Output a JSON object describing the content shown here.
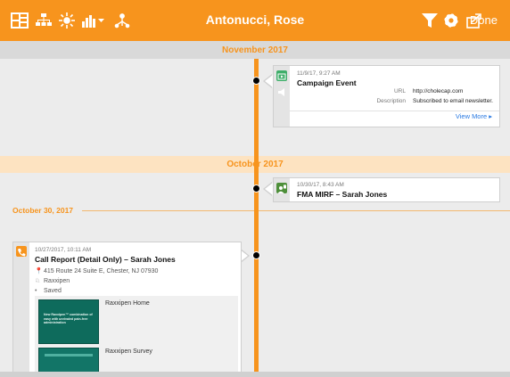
{
  "header": {
    "title": "Antonucci, Rose",
    "done_label": "Done",
    "icons": [
      "layout-icon",
      "hierarchy-icon",
      "sun-icon",
      "bar-chart-dropdown-icon",
      "network-icon",
      "filter-icon",
      "gear-icon",
      "share-icon"
    ]
  },
  "bands": {
    "november": "November 2017",
    "october": "October 2017"
  },
  "events": {
    "campaign": {
      "timestamp": "11/9/17, 9:27 AM",
      "title": "Campaign Event",
      "url_key": "URL",
      "url_val": "http://cholecap.com",
      "desc_key": "Description",
      "desc_val": "Subscribed to email newsletter.",
      "view_more": "View More ▸"
    },
    "fma": {
      "timestamp": "10/30/17, 8:43 AM",
      "title": "FMA MIRF – Sarah Jones"
    },
    "date_divider": "October 30, 2017",
    "call": {
      "timestamp": "10/27/2017, 10:11 AM",
      "title": "Call Report (Detail Only) – Sarah Jones",
      "address": "415 Route 24 Suite E, Chester, NJ 07930",
      "product": "Raxxipen",
      "status": "Saved",
      "slides": [
        {
          "label": "Raxxipen Home",
          "thumb_text": "New Raxxipen™ combination of easy with unrivaled pain-free administration"
        },
        {
          "label": "Raxxipen Survey"
        }
      ]
    }
  },
  "colors": {
    "accent": "#f7941d",
    "link": "#2a7ae2",
    "campaign_icon": "#3fae6a",
    "slide_bg": "#0e6b5c"
  }
}
